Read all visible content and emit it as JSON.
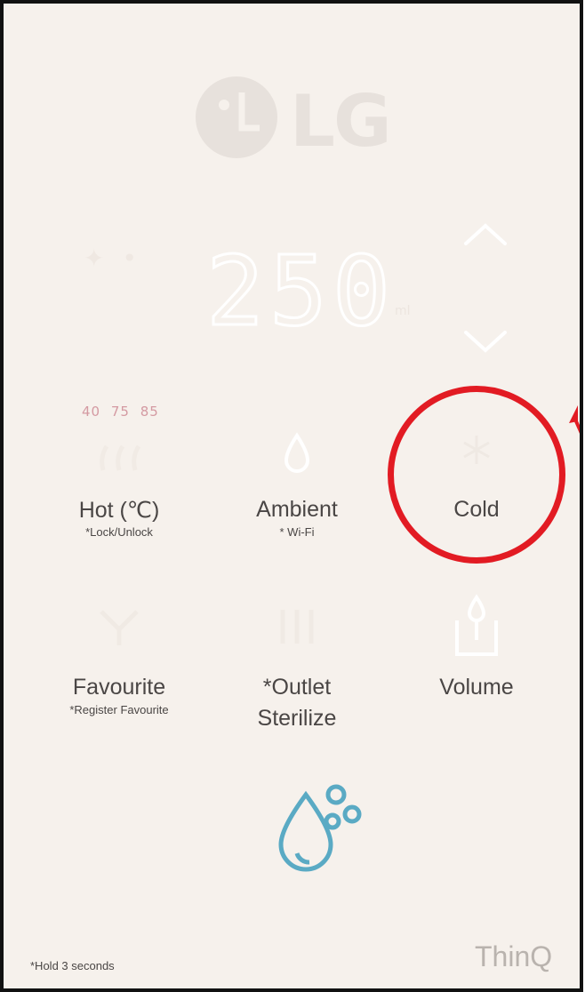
{
  "logo": {
    "brand": "LG",
    "icon": "lg-face-logo-icon"
  },
  "display": {
    "value": "250",
    "unit": "ml"
  },
  "hot_temps": "40 75 85",
  "buttons": [
    {
      "label": "Hot (℃)",
      "sub": "*Lock/Unlock",
      "icon": "hot-water-icon"
    },
    {
      "label": "Ambient",
      "sub": "* Wi-Fi",
      "icon": "water-drop-icon"
    },
    {
      "label": "Cold",
      "sub": "",
      "icon": "snowflake-icon"
    },
    {
      "label": "Favourite",
      "sub": "*Register Favourite",
      "icon": "favourite-cup-icon"
    },
    {
      "label": "*Outlet",
      "label2": "Sterilize",
      "sub": "",
      "icon": "sterilize-icon"
    },
    {
      "label": "Volume",
      "sub": "",
      "icon": "volume-cup-icon"
    }
  ],
  "footer": {
    "hold_note": "*Hold 3 seconds",
    "brand": "ThinQ"
  },
  "colors": {
    "highlight": "#e21b23",
    "dispense_icon": "#5aaac4"
  }
}
